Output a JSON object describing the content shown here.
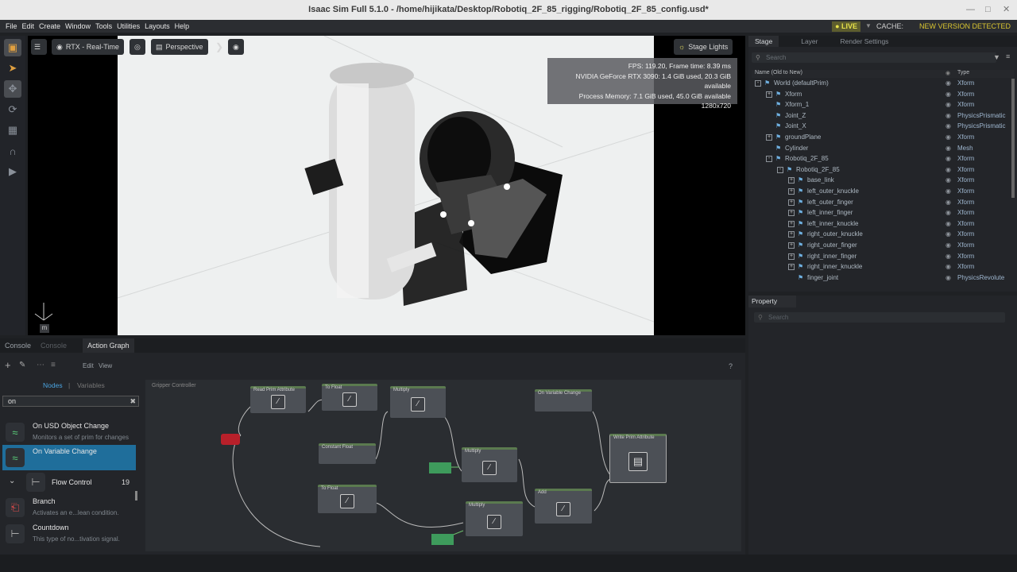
{
  "window": {
    "title": "Isaac Sim Full 5.1.0 - /home/hijikata/Desktop/Robotiq_2F_85_rigging/Robotiq_2F_85_config.usd*"
  },
  "menu": {
    "items": [
      "File",
      "Edit",
      "Create",
      "Window",
      "Tools",
      "Utilities",
      "Layouts",
      "Help"
    ],
    "live": "LIVE",
    "cache": "CACHE:",
    "new_version": "NEW VERSION DETECTED"
  },
  "viewport": {
    "render_mode": "RTX - Real-Time",
    "camera": "Perspective",
    "lights": "Stage Lights",
    "stats": [
      "FPS: 119.20, Frame time: 8.39 ms",
      "NVIDIA GeForce RTX 3090: 1.4 GiB used, 20.3 GiB available",
      "Process Memory: 7.1 GiB used, 45.0 GiB available",
      "1280x720"
    ],
    "axis_label": "m"
  },
  "dock": {
    "tabs": [
      "Console",
      "Console",
      "Action Graph"
    ],
    "edit": "Edit",
    "view": "View",
    "nodes_tab": "Nodes",
    "variables_tab": "Variables",
    "search_value": "on",
    "help": "?"
  },
  "node_list": [
    {
      "title": "On USD Object Change",
      "desc": "Monitors a set of prim for changes"
    },
    {
      "title": "On Variable Change",
      "desc": ""
    },
    {
      "title": "Flow Control",
      "count": "19"
    },
    {
      "title": "Branch",
      "desc": "Activates an e...lean condition."
    },
    {
      "title": "Countdown",
      "desc": "This type of no...tivation signal."
    }
  ],
  "graph": {
    "title": "Gripper Controller",
    "nodes": [
      "Read Prim Attribute",
      "To Float",
      "Multiply",
      "Constant Float",
      "Multiply",
      "Subtract",
      "On Variable Change",
      "Write Prim Attribute",
      "To Float",
      "Multiply",
      "Add"
    ]
  },
  "stage": {
    "tabs": [
      "Stage",
      "Layer",
      "Render Settings"
    ],
    "search_placeholder": "Search",
    "col_name": "Name (Old to New)",
    "col_type": "Type",
    "rows": [
      {
        "name": "World (defaultPrim)",
        "type": "Xform",
        "indent": 0,
        "exp": "-"
      },
      {
        "name": "Xform",
        "type": "Xform",
        "indent": 1,
        "exp": "+"
      },
      {
        "name": "Xform_1",
        "type": "Xform",
        "indent": 1,
        "exp": ""
      },
      {
        "name": "Joint_Z",
        "type": "PhysicsPrismatic",
        "indent": 1,
        "exp": ""
      },
      {
        "name": "Joint_X",
        "type": "PhysicsPrismatic",
        "indent": 1,
        "exp": ""
      },
      {
        "name": "groundPlane",
        "type": "Xform",
        "indent": 1,
        "exp": "+"
      },
      {
        "name": "Cylinder",
        "type": "Mesh",
        "indent": 1,
        "exp": ""
      },
      {
        "name": "Robotiq_2F_85",
        "type": "Xform",
        "indent": 1,
        "exp": "-"
      },
      {
        "name": "Robotiq_2F_85",
        "type": "Xform",
        "indent": 2,
        "exp": "-"
      },
      {
        "name": "base_link",
        "type": "Xform",
        "indent": 3,
        "exp": "+"
      },
      {
        "name": "left_outer_knuckle",
        "type": "Xform",
        "indent": 3,
        "exp": "+"
      },
      {
        "name": "left_outer_finger",
        "type": "Xform",
        "indent": 3,
        "exp": "+"
      },
      {
        "name": "left_inner_finger",
        "type": "Xform",
        "indent": 3,
        "exp": "+"
      },
      {
        "name": "left_inner_knuckle",
        "type": "Xform",
        "indent": 3,
        "exp": "+"
      },
      {
        "name": "right_outer_knuckle",
        "type": "Xform",
        "indent": 3,
        "exp": "+"
      },
      {
        "name": "right_outer_finger",
        "type": "Xform",
        "indent": 3,
        "exp": "+"
      },
      {
        "name": "right_inner_finger",
        "type": "Xform",
        "indent": 3,
        "exp": "+"
      },
      {
        "name": "right_inner_knuckle",
        "type": "Xform",
        "indent": 3,
        "exp": "+"
      },
      {
        "name": "finger_joint",
        "type": "PhysicsRevolute",
        "indent": 3,
        "exp": ""
      }
    ]
  },
  "property": {
    "title": "Property",
    "search_placeholder": "Search"
  }
}
